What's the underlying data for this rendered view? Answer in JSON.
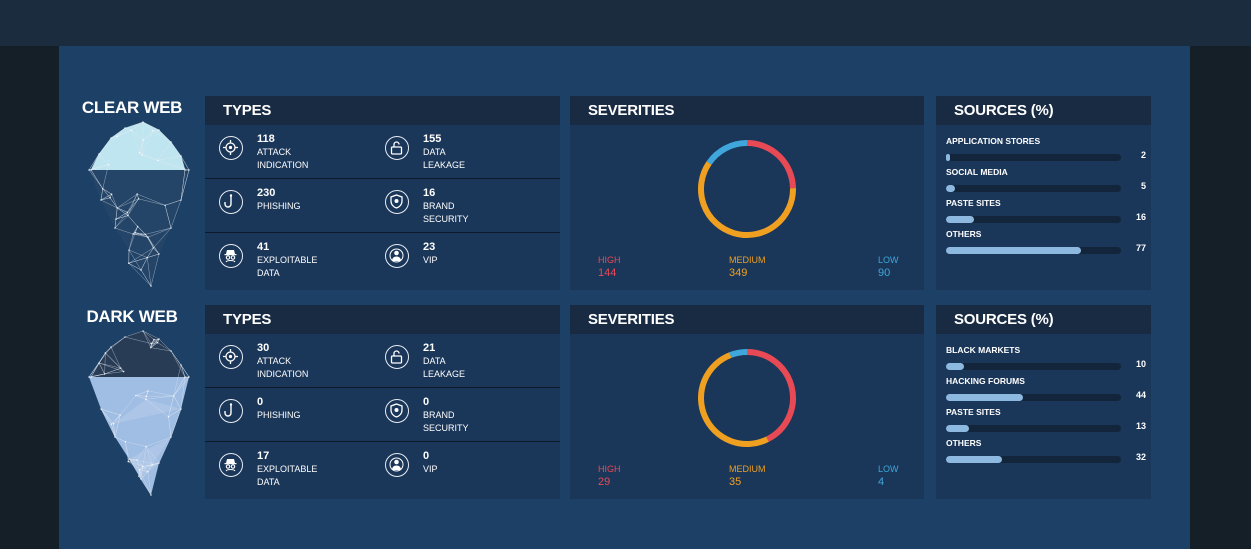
{
  "sections": [
    {
      "title": "CLEAR WEB",
      "types": {
        "heading": "TYPES",
        "items": [
          {
            "value": "118",
            "label": "ATTACK\nINDICATION",
            "icon": "target-icon"
          },
          {
            "value": "155",
            "label": "DATA\nLEAKAGE",
            "icon": "unlock-icon"
          },
          {
            "value": "230",
            "label": "PHISHING",
            "icon": "hook-icon"
          },
          {
            "value": "16",
            "label": "BRAND\nSECURITY",
            "icon": "shield-icon"
          },
          {
            "value": "41",
            "label": "EXPLOITABLE\nDATA",
            "icon": "spy-icon"
          },
          {
            "value": "23",
            "label": "VIP",
            "icon": "vip-user-icon"
          }
        ]
      },
      "severities": {
        "heading": "SEVERITIES",
        "high": {
          "label": "HIGH",
          "value": "144",
          "count": 144
        },
        "medium": {
          "label": "MEDIUM",
          "value": "349",
          "count": 349
        },
        "low": {
          "label": "LOW",
          "value": "90",
          "count": 90
        }
      },
      "sources": {
        "heading": "SOURCES (%)",
        "items": [
          {
            "label": "APPLICATION STORES",
            "value": "2",
            "percent": 2
          },
          {
            "label": "SOCIAL MEDIA",
            "value": "5",
            "percent": 5
          },
          {
            "label": "PASTE SITES",
            "value": "16",
            "percent": 16
          },
          {
            "label": "OTHERS",
            "value": "77",
            "percent": 77
          }
        ]
      }
    },
    {
      "title": "DARK WEB",
      "types": {
        "heading": "TYPES",
        "items": [
          {
            "value": "30",
            "label": "ATTACK\nINDICATION",
            "icon": "target-icon"
          },
          {
            "value": "21",
            "label": "DATA\nLEAKAGE",
            "icon": "unlock-icon"
          },
          {
            "value": "0",
            "label": "PHISHING",
            "icon": "hook-icon"
          },
          {
            "value": "0",
            "label": "BRAND\nSECURITY",
            "icon": "shield-icon"
          },
          {
            "value": "17",
            "label": "EXPLOITABLE\nDATA",
            "icon": "spy-icon"
          },
          {
            "value": "0",
            "label": "VIP",
            "icon": "vip-user-icon"
          }
        ]
      },
      "severities": {
        "heading": "SEVERITIES",
        "high": {
          "label": "HIGH",
          "value": "29",
          "count": 29
        },
        "medium": {
          "label": "MEDIUM",
          "value": "35",
          "count": 35
        },
        "low": {
          "label": "LOW",
          "value": "4",
          "count": 4
        }
      },
      "sources": {
        "heading": "SOURCES (%)",
        "items": [
          {
            "label": "BLACK MARKETS",
            "value": "10",
            "percent": 10
          },
          {
            "label": "HACKING FORUMS",
            "value": "44",
            "percent": 44
          },
          {
            "label": "PASTE SITES",
            "value": "13",
            "percent": 13
          },
          {
            "label": "OTHERS",
            "value": "32",
            "percent": 32
          }
        ]
      }
    }
  ],
  "colors": {
    "high": "#e84a55",
    "medium": "#f0a021",
    "low": "#3fa7dc",
    "bar_fill": "#8db8e0",
    "background": "#1c4066",
    "panel": "#1a3658"
  }
}
